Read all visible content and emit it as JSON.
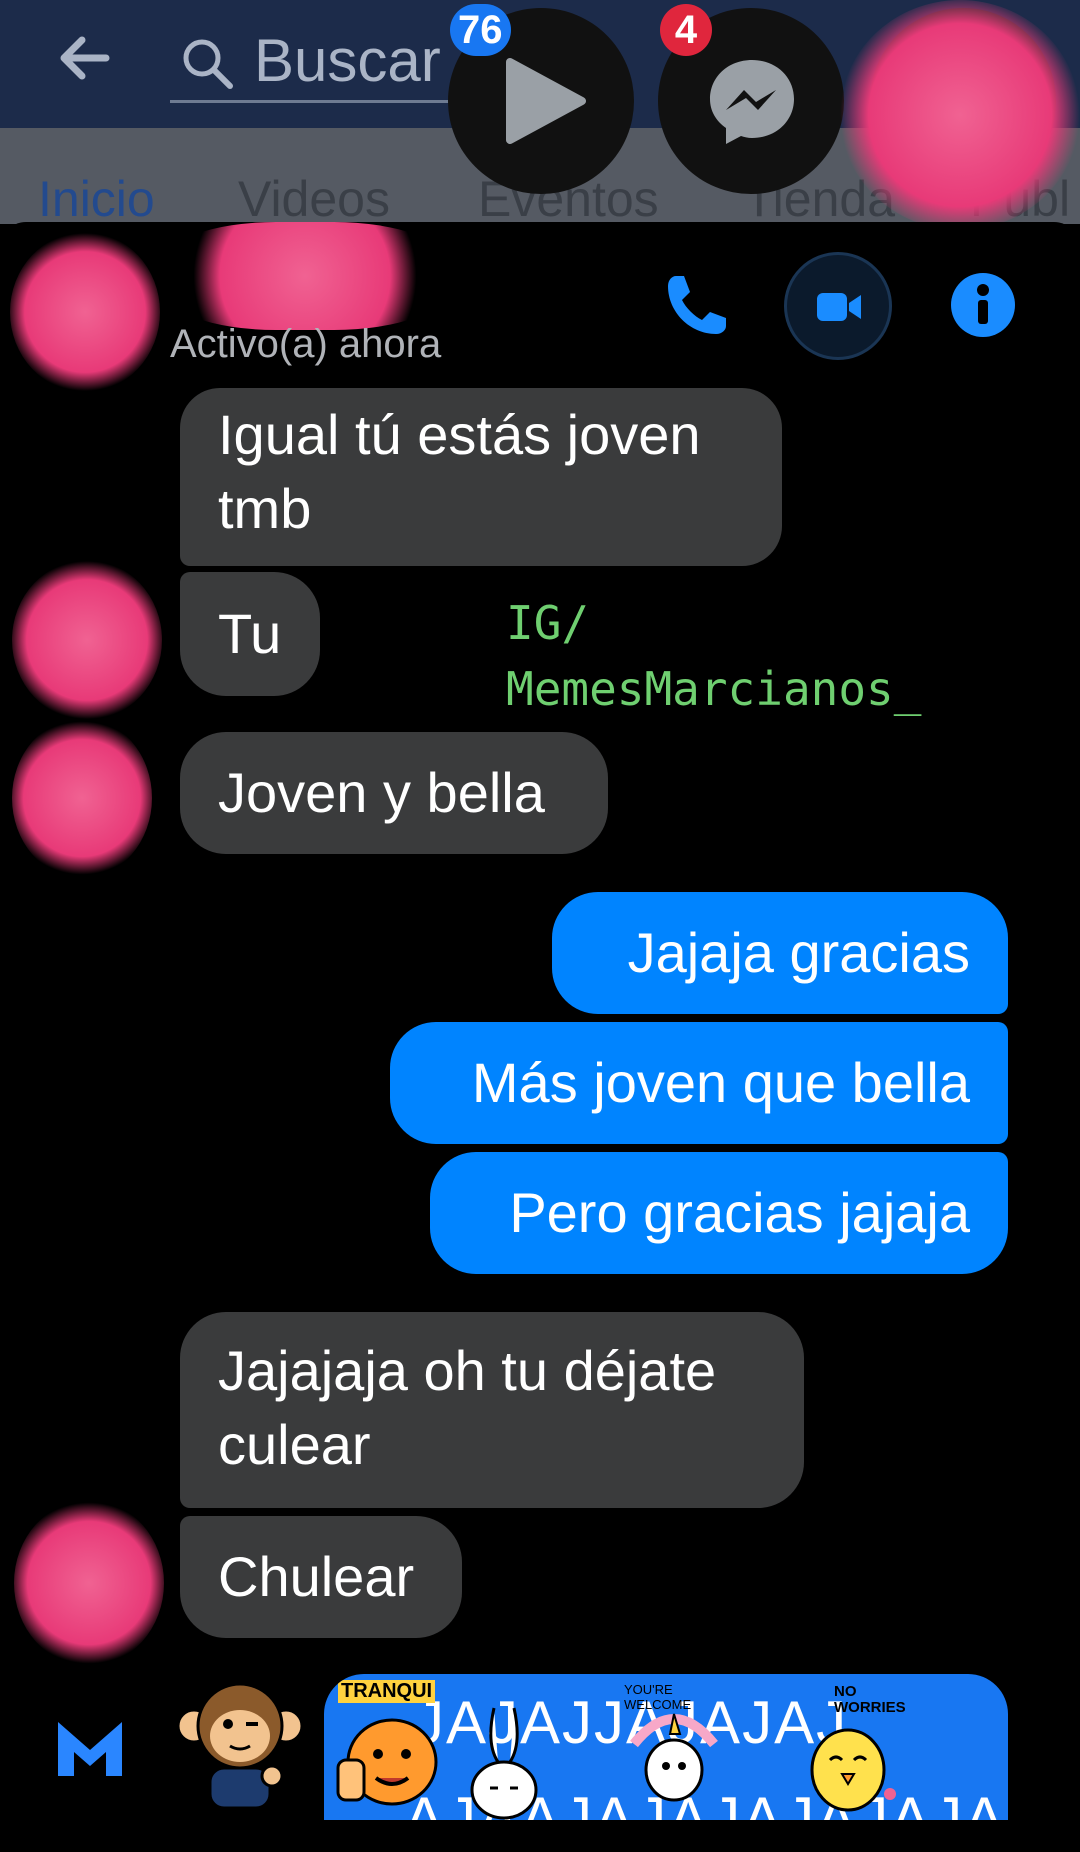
{
  "facebook": {
    "search_placeholder": "Buscar",
    "tabs": [
      "Inicio",
      "Videos",
      "Eventos",
      "Tienda",
      "Publ"
    ],
    "video_badge": "76",
    "messenger_badge": "4"
  },
  "chat_header": {
    "status": "Activo(a) ahora"
  },
  "messages": [
    {
      "side": "in",
      "text_line1": "Igual tú estás joven",
      "text_line2": "tmb"
    },
    {
      "side": "in",
      "text": "Tu"
    },
    {
      "side": "in",
      "text": "Joven y bella"
    },
    {
      "side": "out",
      "text": "Jajaja gracias"
    },
    {
      "side": "out",
      "text": "Más joven que bella"
    },
    {
      "side": "out",
      "text": "Pero gracias jajaja"
    },
    {
      "side": "in",
      "text_line1": "Jajajaja oh tu déjate",
      "text_line2": "culear"
    },
    {
      "side": "in",
      "text": "Chulear"
    }
  ],
  "watermark": {
    "line1": "IG/",
    "line2": "MemesMarcianos_"
  },
  "sticker_bar": {
    "labels": [
      "TRANQUI",
      "YOU'RE WELCOME",
      "NO WORRIES"
    ],
    "text_row1": "JAJAJJAJAJAJ",
    "text_row2": "AJAAJAJAJAJAJAJA"
  },
  "colors": {
    "incoming": "#3a3b3c",
    "outgoing": "#0084ff",
    "accent": "#1877f2"
  }
}
